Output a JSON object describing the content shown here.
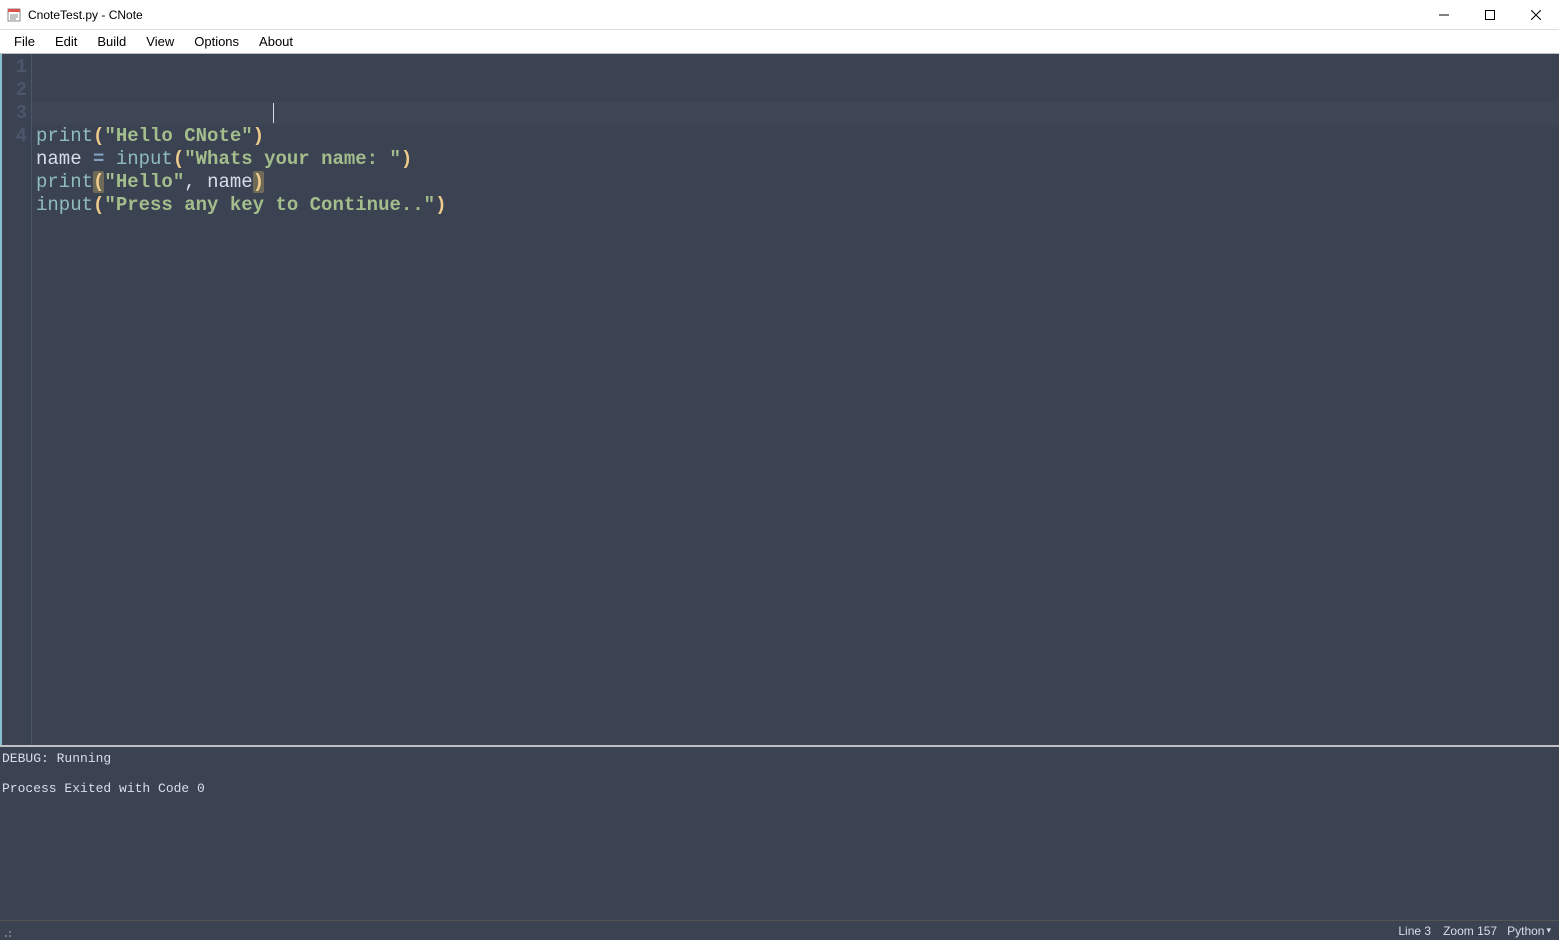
{
  "window": {
    "title": "CnoteTest.py - CNote",
    "icon": "notepad-icon"
  },
  "menu": {
    "items": [
      "File",
      "Edit",
      "Build",
      "View",
      "Options",
      "About"
    ]
  },
  "editor": {
    "line_numbers": [
      "1",
      "2",
      "3",
      "4"
    ],
    "lines": [
      [
        {
          "t": "print",
          "c": "tok-fn"
        },
        {
          "t": "(",
          "c": "tok-paren"
        },
        {
          "t": "\"Hello CNote\"",
          "c": "tok-str"
        },
        {
          "t": ")",
          "c": "tok-paren"
        }
      ],
      [
        {
          "t": "name",
          "c": "tok-ident"
        },
        {
          "t": " ",
          "c": ""
        },
        {
          "t": "=",
          "c": "tok-op"
        },
        {
          "t": " ",
          "c": ""
        },
        {
          "t": "input",
          "c": "tok-fn"
        },
        {
          "t": "(",
          "c": "tok-paren"
        },
        {
          "t": "\"Whats your name: \"",
          "c": "tok-str"
        },
        {
          "t": ")",
          "c": "tok-paren"
        }
      ],
      [
        {
          "t": "print",
          "c": "tok-fn"
        },
        {
          "t": "(",
          "c": "tok-paren paren-hl"
        },
        {
          "t": "\"Hello\"",
          "c": "tok-str"
        },
        {
          "t": ",",
          "c": "tok-comma"
        },
        {
          "t": " ",
          "c": ""
        },
        {
          "t": "name",
          "c": "tok-ident"
        },
        {
          "t": ")",
          "c": "tok-paren paren-hl"
        }
      ],
      [
        {
          "t": "input",
          "c": "tok-fn"
        },
        {
          "t": "(",
          "c": "tok-paren"
        },
        {
          "t": "\"Press any key to Continue..\"",
          "c": "tok-str"
        },
        {
          "t": ")",
          "c": "tok-paren"
        }
      ]
    ],
    "cursor_line_index": 2
  },
  "output": {
    "lines": [
      "DEBUG: Running",
      "",
      "Process Exited with Code 0"
    ]
  },
  "status": {
    "line_info": "Line 3",
    "zoom_info": "Zoom 157",
    "language": "Python"
  }
}
